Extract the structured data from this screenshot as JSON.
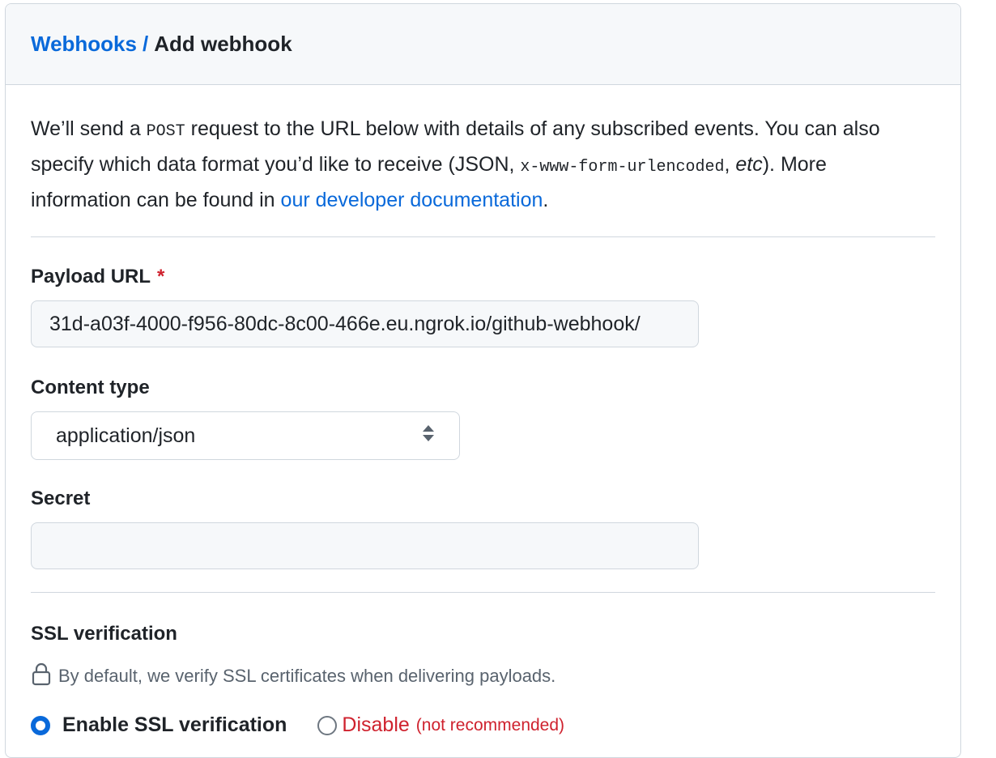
{
  "breadcrumb": {
    "parent": "Webhooks",
    "separator": "/",
    "current": "Add webhook"
  },
  "intro": {
    "part1": "We’ll send a ",
    "method": "POST",
    "part2": " request to the URL below with details of any subscribed events. You can also specify which data format you’d like to receive (JSON, ",
    "format": "x-www-form-urlencoded",
    "part3": ", ",
    "etc": "etc",
    "part4": "). More information can be found in ",
    "link": "our developer documentation",
    "part5": "."
  },
  "payload_url": {
    "label": "Payload URL",
    "required_mark": "*",
    "value": "31d-a03f-4000-f956-80dc-8c00-466e.eu.ngrok.io/github-webhook/"
  },
  "content_type": {
    "label": "Content type",
    "value": "application/json"
  },
  "secret": {
    "label": "Secret",
    "value": ""
  },
  "ssl": {
    "title": "SSL verification",
    "description": "By default, we verify SSL certificates when delivering payloads.",
    "enable_label": "Enable SSL verification",
    "disable_label": "Disable",
    "disable_note": "(not recommended)"
  },
  "colors": {
    "link": "#0969da",
    "danger": "#cf222e",
    "border": "#d0d7de"
  },
  "icons": [
    "lock-icon",
    "select-arrows-icon"
  ]
}
